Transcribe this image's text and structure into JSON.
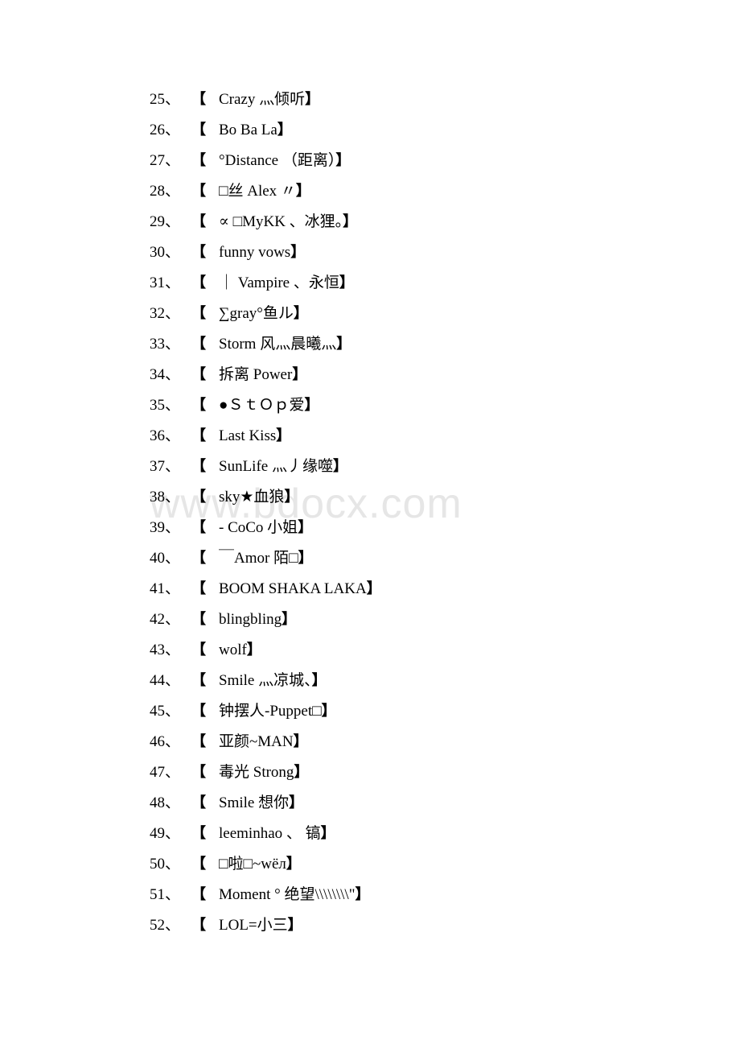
{
  "page": {
    "background_color": "#ffffff",
    "text_color": "#000000",
    "watermark": {
      "text": "www.bdocx.com",
      "color": "#e6e6e6"
    }
  },
  "list": {
    "separator": "、",
    "open_bracket": "【",
    "close_bracket": "】",
    "items": [
      {
        "index": "25",
        "text": "Crazy 灬倾听"
      },
      {
        "index": "26",
        "text": "Bo Ba La"
      },
      {
        "index": "27",
        "text": "°Distance （距离）"
      },
      {
        "index": "28",
        "text": "□丝 Alex 〃"
      },
      {
        "index": "29",
        "text": "∝ □MyKK 、冰狸。"
      },
      {
        "index": "30",
        "text": "funny vows"
      },
      {
        "index": "31",
        "text": "｜ Vampire 、永恒"
      },
      {
        "index": "32",
        "text": "∑gray°鱼ル"
      },
      {
        "index": "33",
        "text": "Storm 风灬晨曦灬"
      },
      {
        "index": "34",
        "text": "拆离 Power"
      },
      {
        "index": "35",
        "text": "●ＳｔＯｐ爱"
      },
      {
        "index": "36",
        "text": "Last Kiss"
      },
      {
        "index": "37",
        "text": "SunLife 灬丿缘噬"
      },
      {
        "index": "38",
        "text": "sky★血狼"
      },
      {
        "index": "39",
        "text": "- CoCo 小姐"
      },
      {
        "index": "40",
        "text": "￣Amor 陌□"
      },
      {
        "index": "41",
        "text": "BOOM SHAKA LAKA"
      },
      {
        "index": "42",
        "text": "blingbling"
      },
      {
        "index": "43",
        "text": "wolf"
      },
      {
        "index": "44",
        "text": "Smile 灬凉城、"
      },
      {
        "index": "45",
        "text": "钟摆人-Puppet□"
      },
      {
        "index": "46",
        "text": "亚颜~MAN"
      },
      {
        "index": "47",
        "text": "毒光 Strong"
      },
      {
        "index": "48",
        "text": "Smile 想你"
      },
      {
        "index": "49",
        "text": "leeminhao 、 镐"
      },
      {
        "index": "50",
        "text": "□啦□~wёл"
      },
      {
        "index": "51",
        "text": "Moment ° 绝望\\\\\\\\\\\\\\\\\""
      },
      {
        "index": "52",
        "text": "LOL=小三"
      }
    ]
  }
}
